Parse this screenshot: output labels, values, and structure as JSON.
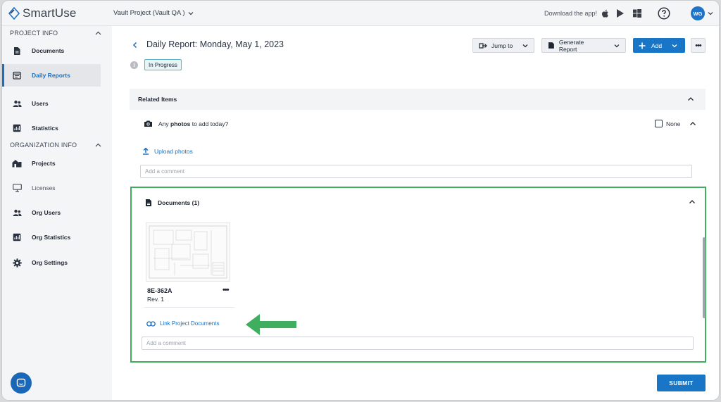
{
  "app": {
    "name": "SmartUse",
    "project": "Vault Project (Vault QA )",
    "download_label": "Download the app!",
    "avatar_initials": "WG",
    "accent": "#1976c7",
    "highlight": "#3fae5f"
  },
  "sidebar": {
    "project_section": "PROJECT INFO",
    "org_section": "ORGANIZATION INFO",
    "project_items": [
      {
        "label": "Documents",
        "icon": "document-icon"
      },
      {
        "label": "Daily Reports",
        "icon": "daily-report-icon",
        "active": true
      },
      {
        "label": "Users",
        "icon": "users-icon"
      },
      {
        "label": "Statistics",
        "icon": "statistics-icon"
      }
    ],
    "org_items": [
      {
        "label": "Projects",
        "icon": "projects-icon"
      },
      {
        "label": "Licenses",
        "icon": "licenses-icon"
      },
      {
        "label": "Org Users",
        "icon": "users-icon"
      },
      {
        "label": "Org Statistics",
        "icon": "statistics-icon"
      },
      {
        "label": "Org Settings",
        "icon": "gear-icon"
      }
    ]
  },
  "header": {
    "title": "Daily Report: Monday, May 1, 2023",
    "status": "In Progress",
    "jump_to": "Jump to",
    "generate_report": "Generate Report",
    "add": "Add"
  },
  "related": {
    "title": "Related Items",
    "photos_prefix": "Any ",
    "photos_bold": "photos",
    "photos_suffix": " to add today?",
    "none_label": "None",
    "upload_label": "Upload photos",
    "comment_placeholder": "Add a comment"
  },
  "documents": {
    "title": "Documents (1)",
    "items": [
      {
        "name": "8E-362A",
        "rev": "Rev. 1"
      }
    ],
    "link_label": "Link Project Documents",
    "comment_placeholder": "Add a comment"
  },
  "footer": {
    "submit": "SUBMIT"
  }
}
